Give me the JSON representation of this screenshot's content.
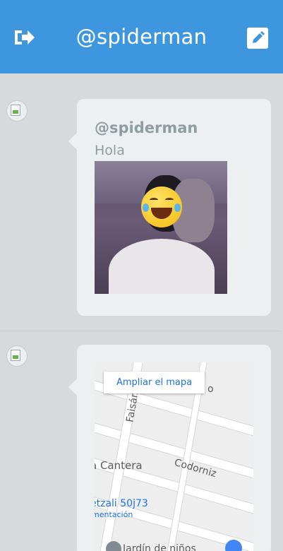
{
  "header": {
    "title": "@spiderman",
    "bg_color": "#3e97de",
    "logout_icon": "logout-icon",
    "edit_icon": "edit-icon"
  },
  "posts": [
    {
      "user": "@spiderman",
      "text": "Hola",
      "attachment": "photo"
    },
    {
      "map": {
        "expand_button": "Ampliar el mapa",
        "labels": [
          "Faisán",
          "a Cantera",
          "Codorniz",
          "etzali 50j73",
          "mentación",
          "Jardín de niños",
          "o"
        ]
      }
    }
  ],
  "colors": {
    "bubble": "#ecf0f1",
    "background": "#d6dadb",
    "text_muted": "#8f9da2",
    "link_blue": "#1a73e8"
  }
}
